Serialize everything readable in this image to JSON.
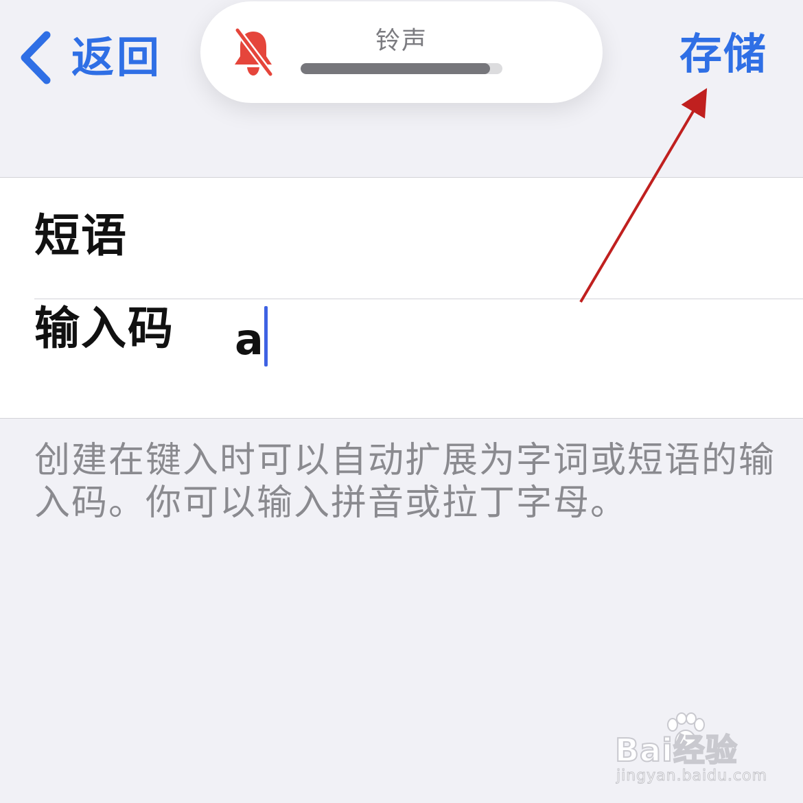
{
  "nav": {
    "back_label": "返回",
    "save_label": "存储"
  },
  "hud": {
    "title": "铃声",
    "icon": "bell-slash-icon",
    "volume_level": 0.94
  },
  "form": {
    "phrase_label": "短语",
    "shortcut_label": "输入码",
    "shortcut_value": "a"
  },
  "footer_note": "创建在键入时可以自动扩展为字词或短语的输入码。你可以输入拼音或拉丁字母。",
  "annotation": {
    "type": "arrow",
    "color": "#c0201f",
    "points_to": "save-button"
  },
  "watermark": {
    "brand": "Bai经验",
    "url": "jingyan.baidu.com"
  },
  "colors": {
    "background": "#f1f1f6",
    "accent": "#2f6fe5",
    "muted_icon": "#e5453b",
    "caret": "#3e62e3",
    "secondary_text": "#8a8a8f"
  }
}
